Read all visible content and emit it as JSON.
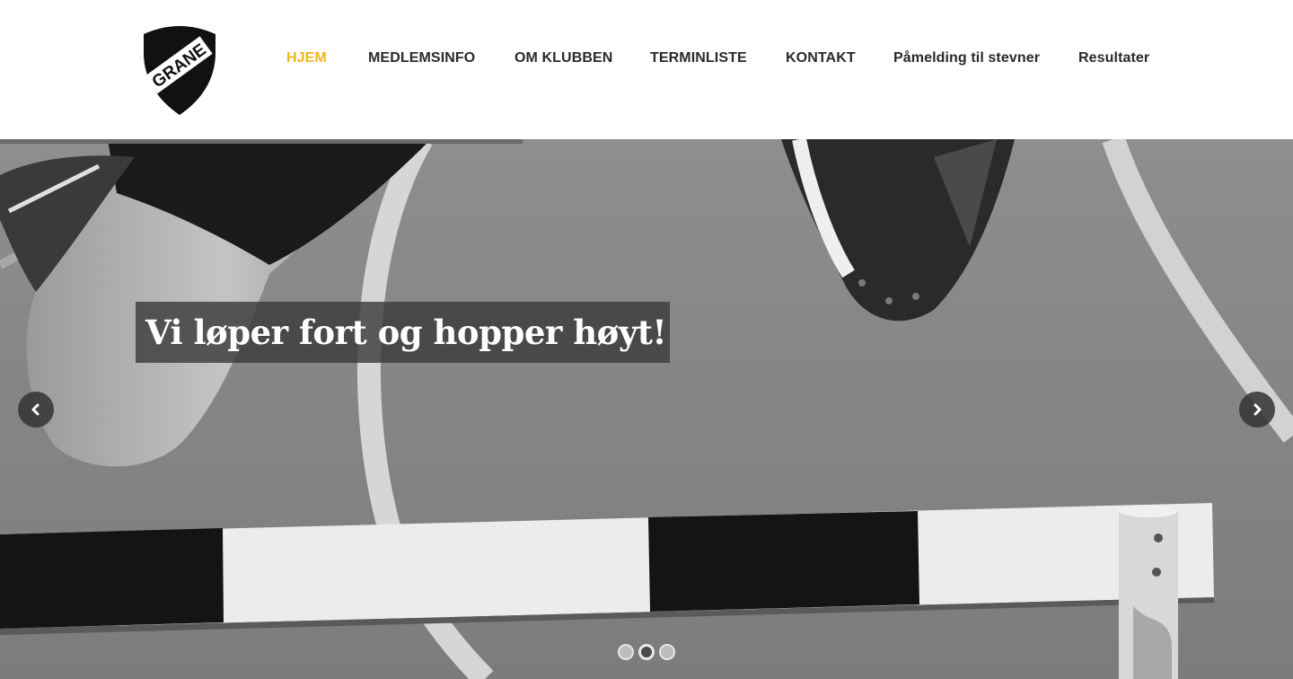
{
  "logo": {
    "text": "GRANE"
  },
  "nav": {
    "items": [
      {
        "label": "HJEM",
        "active": true
      },
      {
        "label": "MEDLEMSINFO",
        "active": false
      },
      {
        "label": "OM KLUBBEN",
        "active": false
      },
      {
        "label": "TERMINLISTE",
        "active": false
      },
      {
        "label": "KONTAKT",
        "active": false
      },
      {
        "label": "Påmelding til stevner",
        "active": false
      },
      {
        "label": "Resultater",
        "active": false
      }
    ]
  },
  "hero": {
    "caption": "Vi løper fort og hopper høyt!",
    "prev_icon": "chevron-left-icon",
    "next_icon": "chevron-right-icon",
    "slides": 3,
    "active_slide": 2
  },
  "colors": {
    "accent": "#f2b61b",
    "nav_text": "#2a2a2a",
    "caption_bg": "#3c3c3c"
  }
}
